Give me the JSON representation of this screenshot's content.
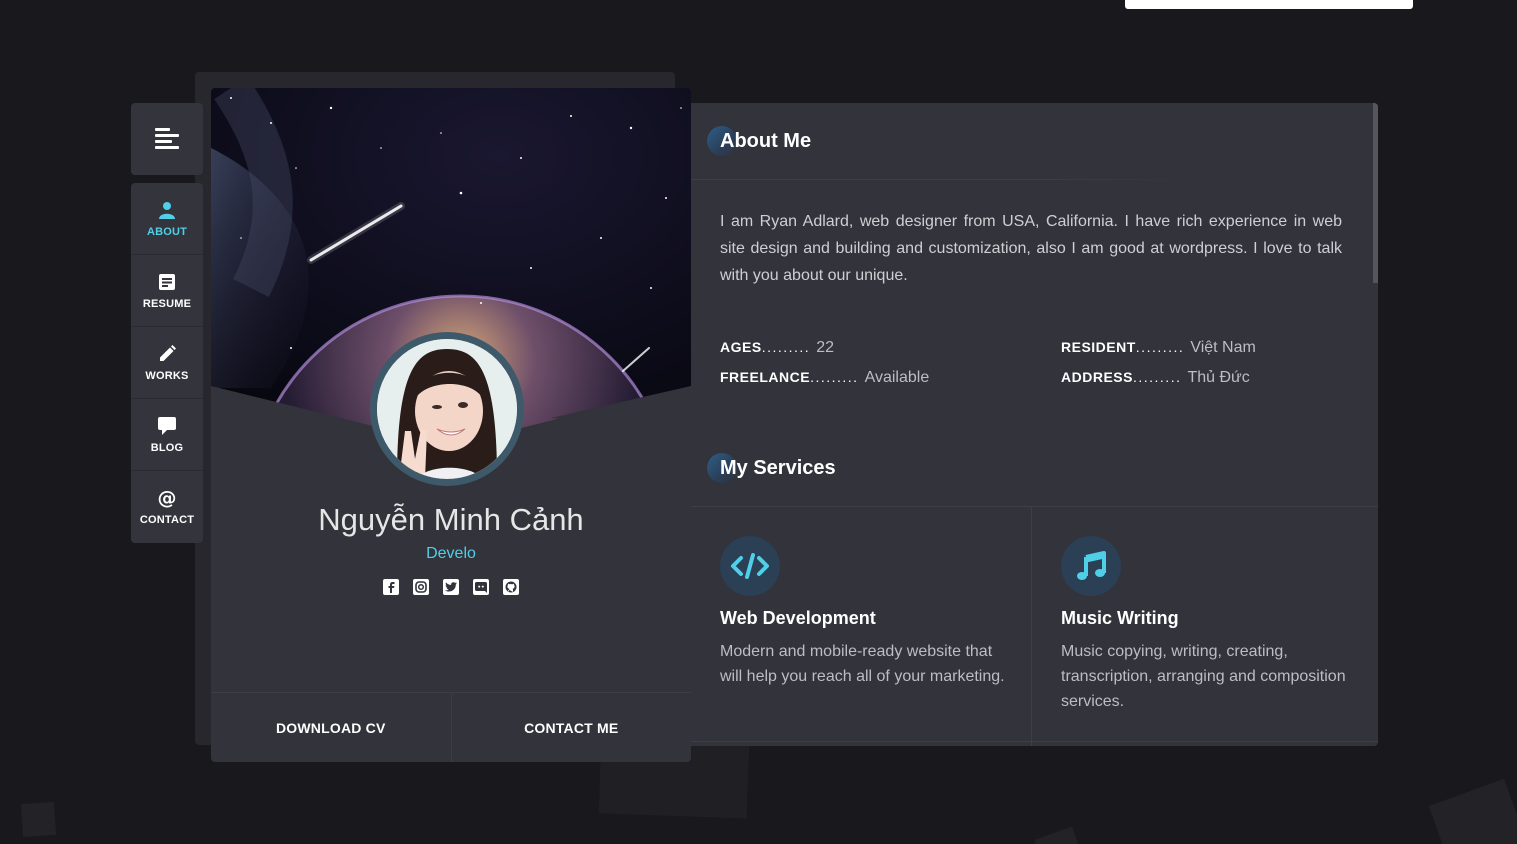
{
  "nav": {
    "items": [
      {
        "label": "ABOUT",
        "icon": "person-icon"
      },
      {
        "label": "RESUME",
        "icon": "resume-icon"
      },
      {
        "label": "WORKS",
        "icon": "pencil-icon"
      },
      {
        "label": "BLOG",
        "icon": "chat-icon"
      },
      {
        "label": "CONTACT",
        "icon": "at-icon"
      }
    ],
    "active": "ABOUT"
  },
  "profile": {
    "name": "Nguyễn Minh Cảnh",
    "subtitle": "Develo",
    "socials": [
      "facebook-icon",
      "instagram-icon",
      "twitter-icon",
      "discord-icon",
      "github-icon"
    ],
    "download_label": "DOWNLOAD CV",
    "contact_label": "CONTACT ME"
  },
  "about": {
    "title": "About Me",
    "text": "I am Ryan Adlard, web designer from USA, California. I have rich experience in web site design and building and customization, also I am good at wordpress. I love to talk with you about our unique.",
    "info": [
      {
        "key": "AGES",
        "dots": ".........",
        "value": "22"
      },
      {
        "key": "RESIDENT",
        "dots": ".........",
        "value": "Việt Nam"
      },
      {
        "key": "FREELANCE",
        "dots": ".........",
        "value": "Available"
      },
      {
        "key": "ADDRESS",
        "dots": ".........",
        "value": "Thủ Đức"
      }
    ]
  },
  "services": {
    "title": "My Services",
    "items": [
      {
        "name": "Web Development",
        "icon": "code-icon",
        "desc": "Modern and mobile-ready website that will help you reach all of your marketing."
      },
      {
        "name": "Music Writing",
        "icon": "music-note-icon",
        "desc": "Music copying, writing, creating, transcription, arranging and composition services."
      }
    ]
  },
  "colors": {
    "accent": "#4fcfe8",
    "background": "#18181d",
    "panel": "#32333b"
  }
}
